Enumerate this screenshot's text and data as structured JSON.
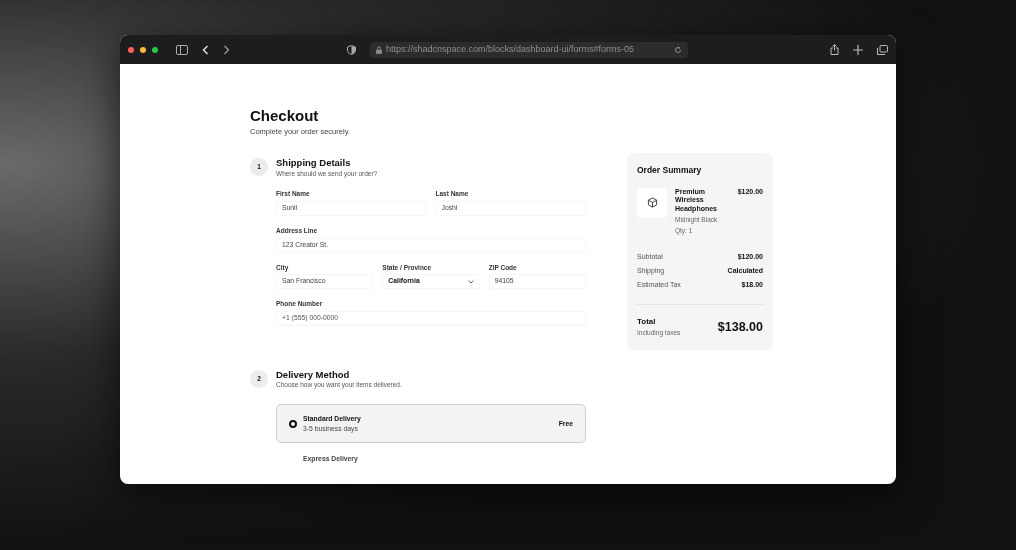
{
  "browser": {
    "url": "https://shadcnspace.com/blocks/dashboard-ui/forms#forms-05"
  },
  "page": {
    "title": "Checkout",
    "subtitle": "Complete your order securely."
  },
  "shipping": {
    "step": "1",
    "title": "Shipping Details",
    "subtitle": "Where should we send your order?",
    "fields": [
      {
        "label": "First Name",
        "value": "Sunil",
        "kind": "text"
      },
      {
        "label": "Last Name",
        "value": "Joshi",
        "kind": "text"
      },
      {
        "label": "Address Line",
        "value": "123 Creator St.",
        "kind": "text"
      },
      {
        "label": "City",
        "value": "San Francisco",
        "kind": "text"
      },
      {
        "label": "State / Province",
        "value": "California",
        "kind": "select"
      },
      {
        "label": "ZIP Code",
        "value": "94105",
        "kind": "text"
      },
      {
        "label": "Phone Number",
        "placeholder": "+1 (555) 000-0000",
        "kind": "text"
      }
    ]
  },
  "delivery": {
    "step": "2",
    "title": "Delivery Method",
    "subtitle": "Choose how you want your items delivered.",
    "options": [
      {
        "name": "Standard Delivery",
        "detail": "3-5 business days",
        "price": "Free",
        "selected": true
      },
      {
        "name": "Express Delivery",
        "selected": false
      }
    ]
  },
  "summary": {
    "title": "Order Summary",
    "item": {
      "name": "Premium Wireless Headphones",
      "variant": "Midnight Black",
      "qty": "Qty: 1",
      "price": "$120.00"
    },
    "lines": [
      {
        "label": "Subtotal",
        "value": "$120.00"
      },
      {
        "label": "Shipping",
        "value": "Calculated"
      },
      {
        "label": "Estimated Tax",
        "value": "$18.00"
      }
    ],
    "total": {
      "label": "Total",
      "note": "Including taxes",
      "value": "$138.00"
    }
  }
}
